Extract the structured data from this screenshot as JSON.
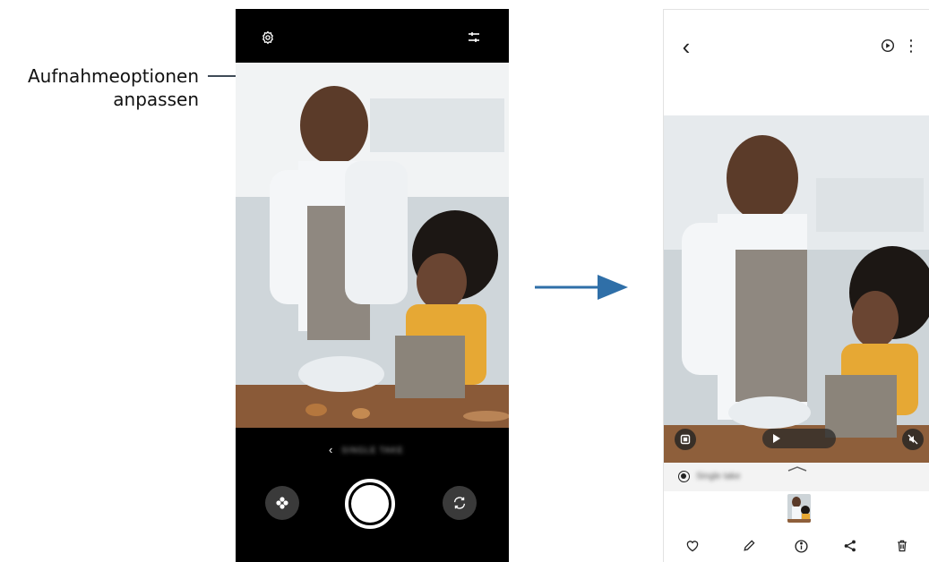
{
  "callout": {
    "line1": "Aufnahmeoptionen",
    "line2": "anpassen"
  },
  "camera_screen": {
    "top_icons": [
      "gear-icon",
      "sliders-icon"
    ],
    "mode_chevron": "‹",
    "mode_label": "SINGLE TAKE",
    "bottom_icons": [
      "effects-icon",
      "shutter-button",
      "switch-camera-icon"
    ]
  },
  "gallery_screen": {
    "back_chevron": "‹",
    "top_icons": [
      "motion-play-icon",
      "more-options-icon"
    ],
    "more_glyph": "⋮",
    "bar_label": "Single take",
    "action_icons": [
      "heart-icon",
      "edit-icon",
      "info-icon",
      "share-icon",
      "delete-icon"
    ]
  },
  "colors": {
    "callout_line": "#3f4b57",
    "arrow": "#2f6fa8",
    "camera_background": "#000000",
    "bar_background": "#f3f3f3"
  }
}
